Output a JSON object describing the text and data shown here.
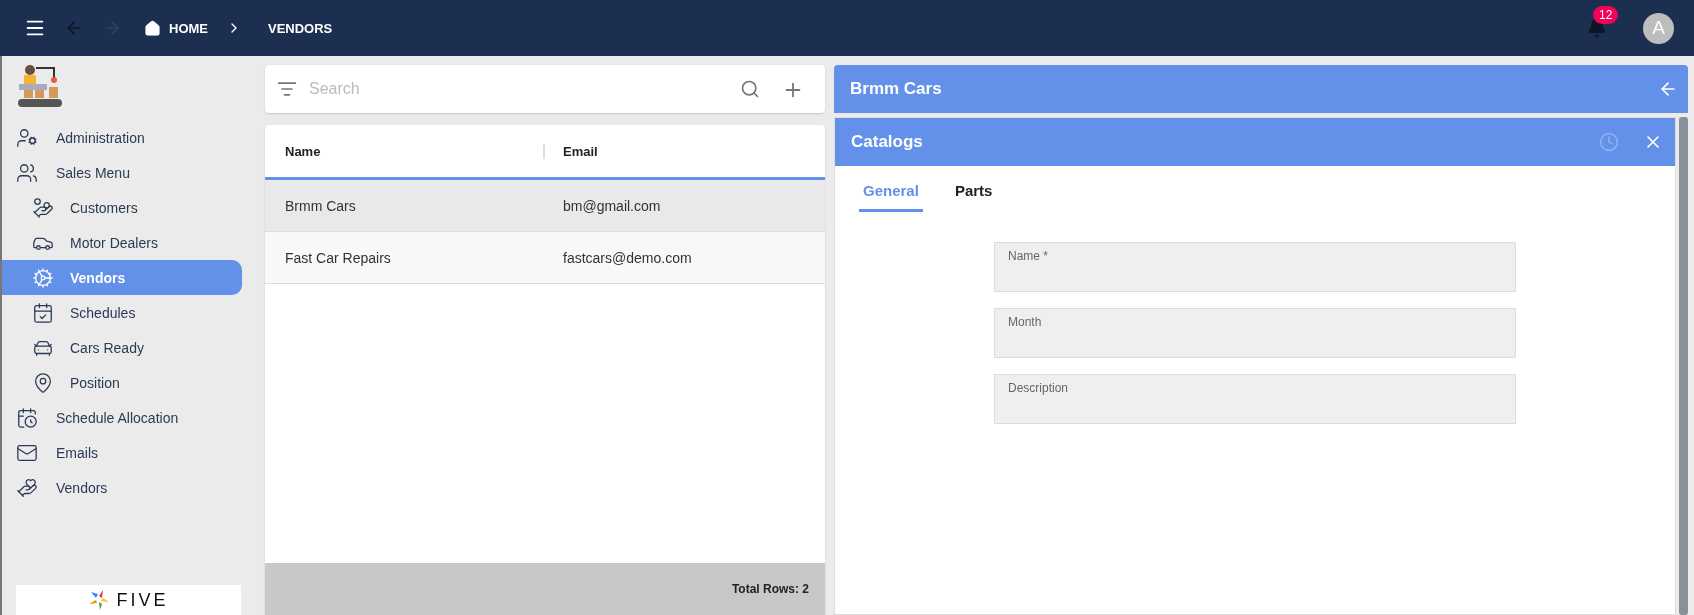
{
  "topbar": {
    "breadcrumbs": [
      {
        "label": "HOME",
        "kind": "home"
      },
      {
        "label": "VENDORS",
        "kind": "page"
      }
    ],
    "notifications": "12",
    "avatar": "A"
  },
  "sidebar": {
    "items": [
      {
        "label": "Administration",
        "selected": false
      },
      {
        "label": "Sales Menu",
        "selected": false,
        "children": [
          {
            "label": "Customers",
            "selected": false
          },
          {
            "label": "Motor Dealers",
            "selected": false
          },
          {
            "label": "Vendors",
            "selected": true
          },
          {
            "label": "Schedules",
            "selected": false
          },
          {
            "label": "Cars Ready",
            "selected": false
          },
          {
            "label": "Position",
            "selected": false
          }
        ]
      },
      {
        "label": "Schedule Allocation",
        "selected": false
      },
      {
        "label": "Emails",
        "selected": false
      },
      {
        "label": "Vendors",
        "selected": false
      }
    ],
    "logo_text": "FIVE"
  },
  "list": {
    "search": {
      "placeholder": "Search"
    },
    "table": {
      "columns": [
        "Name",
        "Email"
      ],
      "rows": [
        {
          "cells": [
            "Brmm Cars",
            "bm@gmail.com"
          ],
          "selected": true
        },
        {
          "cells": [
            "Fast Car Repairs",
            "fastcars@demo.com"
          ],
          "selected": false
        }
      ]
    },
    "footer": "Total Rows: 2"
  },
  "detail": {
    "title": "Brmm Cars",
    "subform": {
      "title": "Catalogs",
      "tabs": [
        {
          "label": "General",
          "selected": true
        },
        {
          "label": "Parts",
          "selected": false
        }
      ],
      "fields": [
        {
          "label": "Name *"
        },
        {
          "label": "Month"
        },
        {
          "label": "Description"
        }
      ]
    }
  }
}
